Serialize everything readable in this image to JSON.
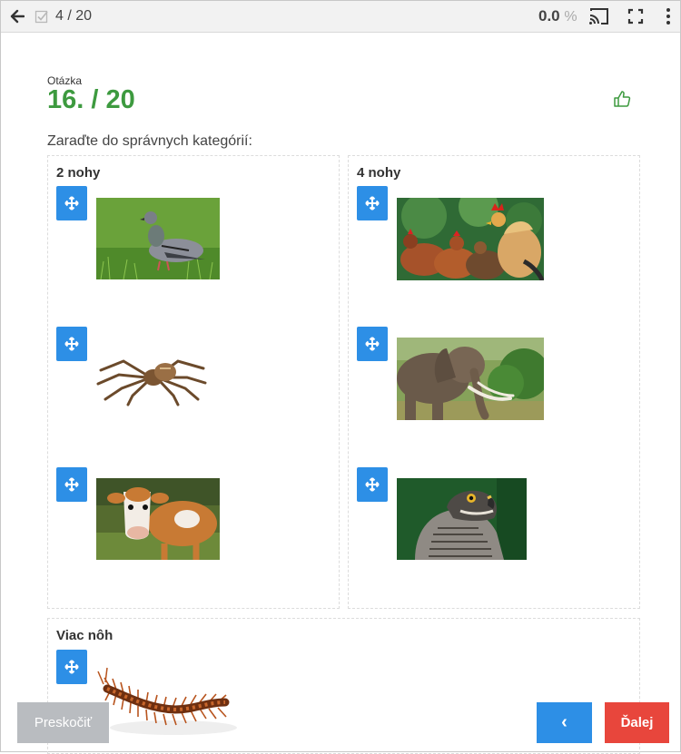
{
  "topbar": {
    "progress": "4 / 20",
    "score_value": "0.0",
    "score_unit": "%"
  },
  "question": {
    "label": "Otázka",
    "number": "16. / 20",
    "instruction": "Zaraďte do správnych kategórií:"
  },
  "categories": [
    {
      "title": "2 nohy",
      "items": [
        "pigeon",
        "spider",
        "cow"
      ]
    },
    {
      "title": "4 nohy",
      "items": [
        "chickens",
        "elephant",
        "hawk"
      ]
    },
    {
      "title": "Viac nôh",
      "items": [
        "centipede"
      ]
    }
  ],
  "footer": {
    "skip_label": "Preskočiť",
    "prev_label": "‹",
    "next_label": "Ďalej"
  },
  "colors": {
    "accent_blue": "#2d8fe6",
    "accent_green": "#3d9a3f",
    "next_red": "#e8463c",
    "skip_gray": "#b9bcc0"
  },
  "icons": {
    "back": "arrow-left-icon",
    "progress": "checkbox-icon",
    "cast": "cast-icon",
    "fullscreen": "fullscreen-icon",
    "more": "more-vertical-icon",
    "like": "thumbs-up-icon",
    "drag": "move-icon"
  }
}
